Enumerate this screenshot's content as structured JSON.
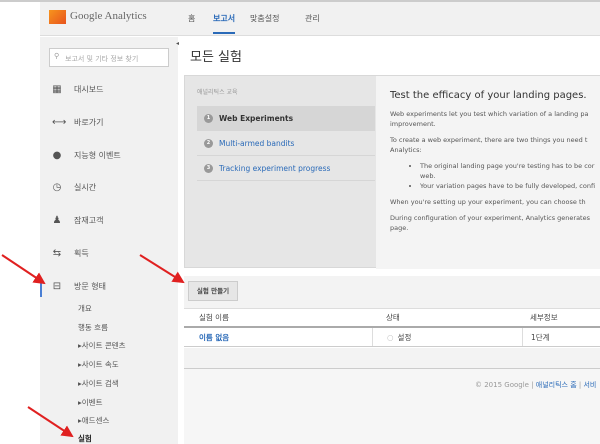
{
  "header": {
    "logo_text": "Google Analytics",
    "nav": [
      "홈",
      "보고서",
      "맞춤설정",
      "관리"
    ],
    "active_nav": "보고서"
  },
  "sidebar": {
    "search_placeholder": "보고서 및 기타 정보 찾기",
    "items": [
      {
        "label": "대시보드",
        "icon": "grid-icon"
      },
      {
        "label": "바로가기",
        "icon": "shortcut-arrow-icon"
      },
      {
        "label": "지능형 이벤트",
        "icon": "map-pin-icon"
      },
      {
        "label": "실시간",
        "icon": "clock-icon"
      },
      {
        "label": "잠재고객",
        "icon": "people-icon"
      },
      {
        "label": "획득",
        "icon": "arrows-icon"
      },
      {
        "label": "방문 형태",
        "icon": "behavior-icon"
      }
    ],
    "subitems": [
      "개요",
      "행동 흐름",
      "▸사이트 콘텐츠",
      "▸사이트 속도",
      "▸사이트 검색",
      "▸이벤트",
      "▸애드센스",
      "실험"
    ],
    "active_subitem": "실험"
  },
  "page": {
    "title": "모든 실험"
  },
  "tutorial": {
    "label": "애널리틱스 교육",
    "steps": [
      "Web Experiments",
      "Multi-armed bandits",
      "Tracking experiment progress"
    ],
    "heading": "Test the efficacy of your landing pages.",
    "p1": "Web experiments let you test which variation of a landing pa",
    "p1b": "improvement.",
    "p2": "To create a web experiment, there are two things you need t",
    "p2b": "Analytics:",
    "bullets": [
      "The original landing page you're testing has to be cor",
      "web.",
      "Your variation pages have to be fully developed, confi"
    ],
    "p3": "When you're setting up your experiment, you can choose th",
    "p4": "During configuration of your experiment, Analytics generates",
    "p4b": "page."
  },
  "toolbar": {
    "create_label": "실험 만들기"
  },
  "table": {
    "headers": [
      "실험 이름",
      "상태",
      "세부정보"
    ],
    "rows": [
      [
        "이름 없음",
        "설정",
        "1단계"
      ]
    ]
  },
  "footer": {
    "copyright": "© 2015 Google |",
    "link1": "애널리틱스 홈",
    "sep": "|",
    "link2": "서비"
  },
  "colors": {
    "accent": "#2a6ab8",
    "annotation_arrow": "#e02020"
  }
}
